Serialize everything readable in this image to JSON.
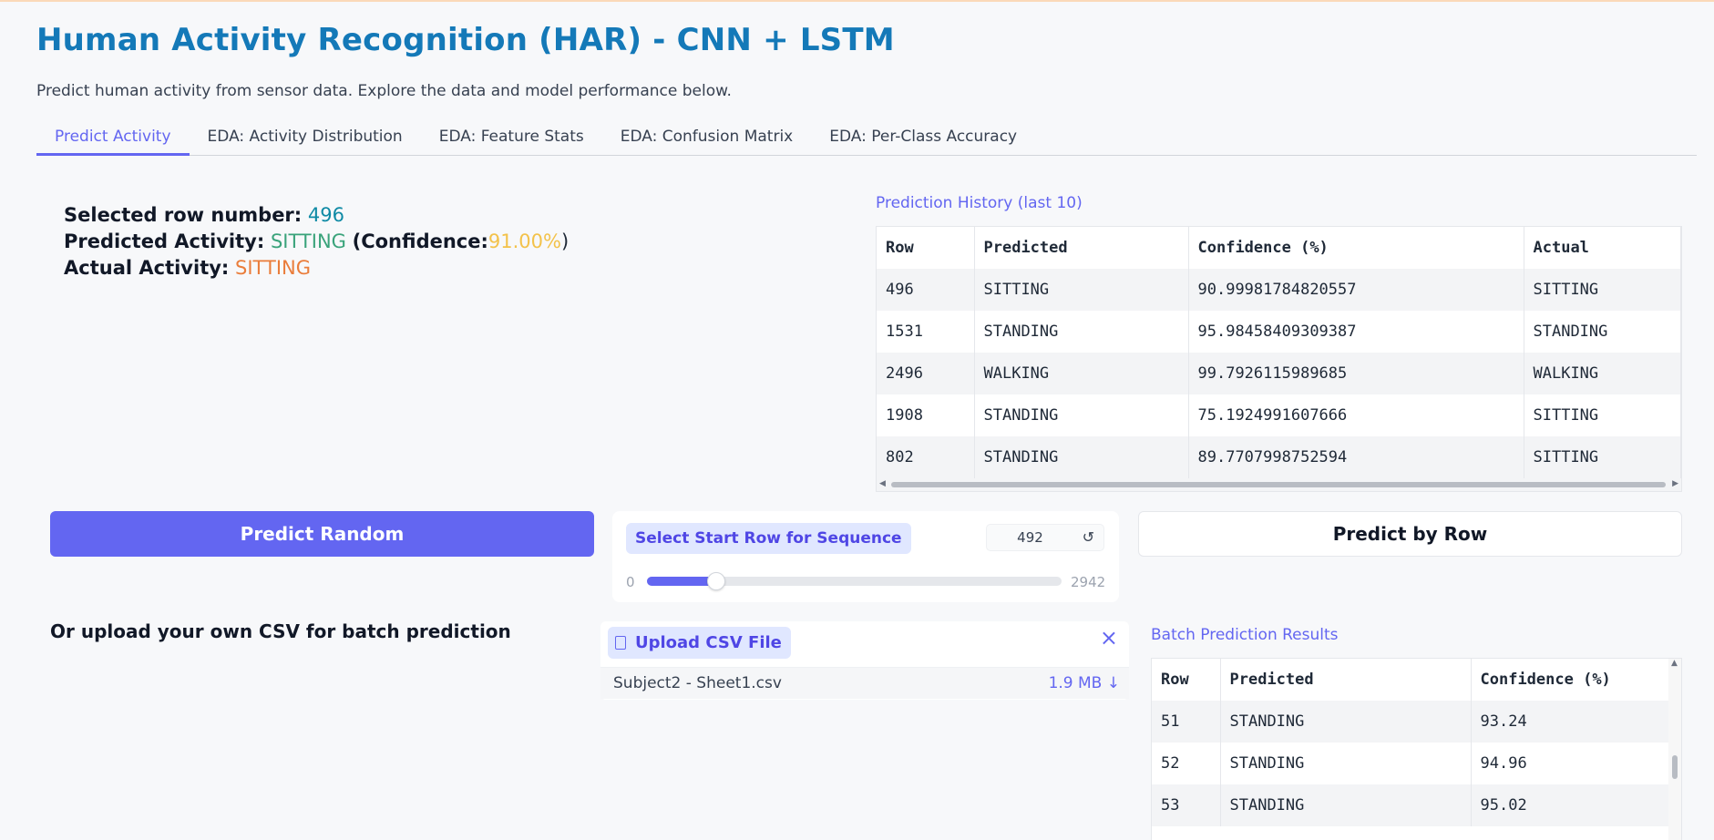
{
  "header": {
    "title": "Human Activity Recognition (HAR) - CNN + LSTM",
    "subtitle": "Predict human activity from sensor data. Explore the data and model performance below."
  },
  "tabs": [
    {
      "label": "Predict Activity",
      "active": true
    },
    {
      "label": "EDA: Activity Distribution",
      "active": false
    },
    {
      "label": "EDA: Feature Stats",
      "active": false
    },
    {
      "label": "EDA: Confusion Matrix",
      "active": false
    },
    {
      "label": "EDA: Per-Class Accuracy",
      "active": false
    }
  ],
  "result": {
    "row_label": "Selected row number:",
    "row_value": "496",
    "pred_label": "Predicted Activity:",
    "pred_value": "SITTING",
    "conf_open": "(Confidence:",
    "conf_value": "91.00%",
    "conf_close": ")",
    "actual_label": "Actual Activity:",
    "actual_value": "SITTING"
  },
  "history": {
    "label": "Prediction History (last 10)",
    "columns": [
      "Row",
      "Predicted",
      "Confidence (%)",
      "Actual"
    ],
    "rows": [
      [
        "496",
        "SITTING",
        "90.99981784820557",
        "SITTING"
      ],
      [
        "1531",
        "STANDING",
        "95.98458409309387",
        "STANDING"
      ],
      [
        "2496",
        "WALKING",
        "99.7926115989685",
        "WALKING"
      ],
      [
        "1908",
        "STANDING",
        "75.1924991607666",
        "SITTING"
      ],
      [
        "802",
        "STANDING",
        "89.7707998752594",
        "SITTING"
      ]
    ]
  },
  "controls": {
    "predict_random": "Predict Random",
    "slider_label": "Select Start Row for Sequence",
    "slider_value": "492",
    "slider_min": "0",
    "slider_max": "2942",
    "reset_icon": "↺",
    "predict_by_row": "Predict by Row"
  },
  "upload": {
    "heading": "Or upload your own CSV for batch prediction",
    "label": "Upload CSV File",
    "close_icon": "×",
    "file_name": "Subject2 - Sheet1.csv",
    "file_size": "1.9 MB ↓"
  },
  "batch": {
    "label": "Batch Prediction Results",
    "columns": [
      "Row",
      "Predicted",
      "Confidence (%)"
    ],
    "rows": [
      [
        "51",
        "STANDING",
        "93.24"
      ],
      [
        "52",
        "STANDING",
        "94.96"
      ],
      [
        "53",
        "STANDING",
        "95.02"
      ]
    ]
  },
  "colors": {
    "accent": "#6366f1",
    "title": "#1479b8",
    "row_value": "#0f8aa5",
    "predicted": "#3aa37b",
    "confidence": "#f3c24a",
    "actual": "#ea7d3b"
  }
}
